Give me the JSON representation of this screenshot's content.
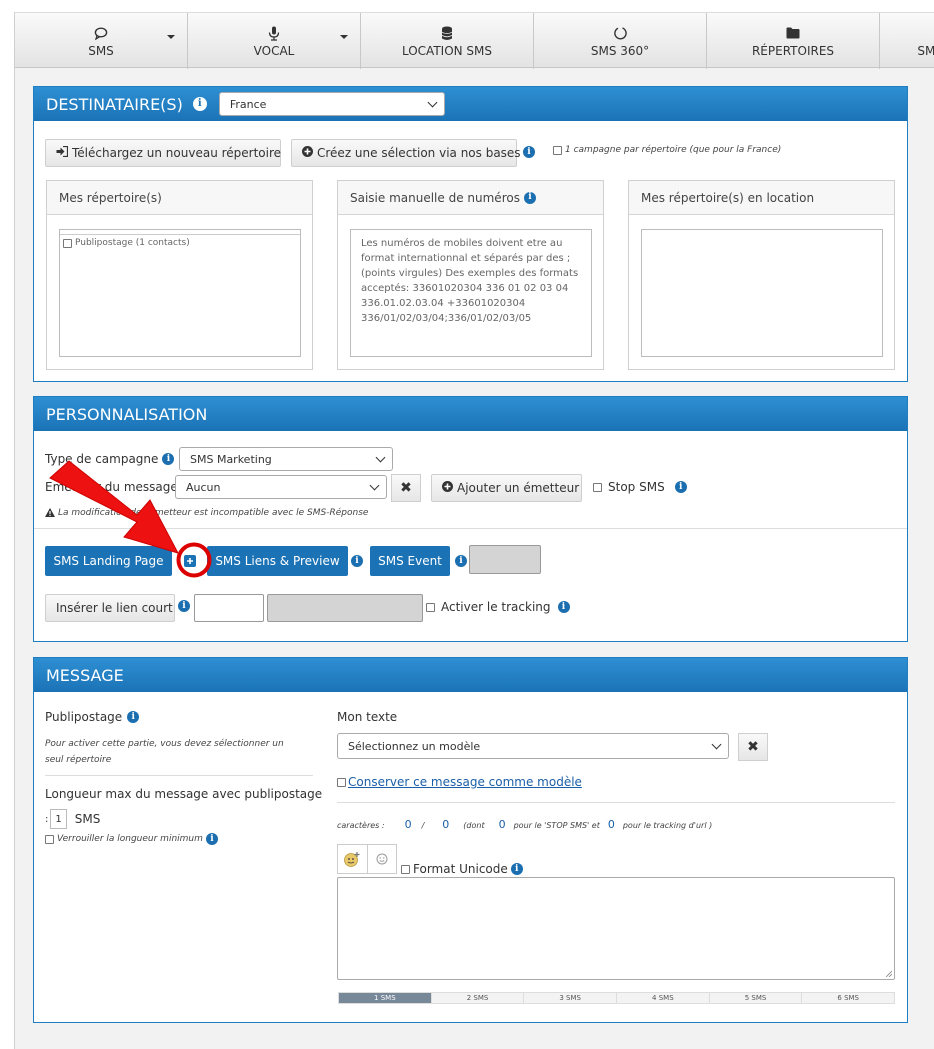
{
  "nav": [
    {
      "label": "SMS",
      "icon": "chat-bubble-icon",
      "dropdown": true
    },
    {
      "label": "VOCAL",
      "icon": "microphone-icon",
      "dropdown": true
    },
    {
      "label": "LOCATION SMS",
      "icon": "database-icon",
      "dropdown": false
    },
    {
      "label": "SMS 360°",
      "icon": "circle-refresh-icon",
      "dropdown": false
    },
    {
      "label": "RÉPERTOIRES",
      "icon": "folder-icon",
      "dropdown": false
    },
    {
      "label": "SMS",
      "icon": "",
      "dropdown": false
    }
  ],
  "destinataires": {
    "title": "DESTINATAIRE(S)",
    "country_selected": "France",
    "upload_button": "Téléchargez un nouveau répertoire",
    "create_button": "Créez une sélection via nos bases",
    "one_campaign_label": "1 campagne par répertoire (que pour la France)",
    "my_repertoires": {
      "title": "Mes répertoire(s)",
      "item": "Publipostage (1 contacts)"
    },
    "manual_entry": {
      "title": "Saisie manuelle de numéros",
      "placeholder": "Les numéros de mobiles doivent etre au format internationnal et séparés par des ; (points virgules) Des exemples des formats acceptés: 33601020304   336 01 02 03 04   336.01.02.03.04   +33601020304   336/01/02/03/04;336/01/02/03/05"
    },
    "rented": {
      "title": "Mes répertoire(s) en location"
    }
  },
  "personnalisation": {
    "title": "PERSONNALISATION",
    "campaign_type_label": "Type de campagne",
    "campaign_type_value": "SMS Marketing",
    "sender_label": "Emetteur du message",
    "sender_value": "Aucun",
    "add_sender_button": "Ajouter un émetteur",
    "stop_sms_label": "Stop SMS",
    "warning": "La modification de l'émetteur est incompatible avec le SMS-Réponse",
    "landing_page_button": "SMS Landing Page",
    "links_preview_button": "SMS Liens & Preview",
    "event_button": "SMS Event",
    "short_link_button": "Insérer le lien court",
    "tracking_label": "Activer le tracking"
  },
  "message": {
    "title": "MESSAGE",
    "publipostage_label": "Publipostage",
    "publipostage_note": "Pour activer cette partie, vous devez sélectionner un seul répertoire",
    "max_length_label": "Longueur max du message avec publipostage",
    "max_length_colon": ":",
    "max_length_value": "1",
    "max_length_unit": "SMS",
    "lock_min_label": "Verrouiller la longueur minimum",
    "my_text_label": "Mon texte",
    "model_select": "Sélectionnez un modèle",
    "keep_model_label": "Conserver ce message comme modèle",
    "chars_label": "caractères :",
    "chars_count": "0",
    "chars_slash": "/",
    "chars_total": "0",
    "dont_label": "(dont",
    "stop_count": "0",
    "stop_label": "pour le 'STOP SMS' et",
    "tracking_count": "0",
    "tracking_label": "pour le tracking d'url )",
    "unicode_label": "Format Unicode",
    "segments": [
      "1 SMS",
      "2 SMS",
      "3 SMS",
      "4 SMS",
      "5 SMS",
      "6 SMS"
    ],
    "active_segment": 0
  },
  "annotation": {
    "arrow_color": "#ee1111",
    "circle_color": "#dd0000"
  },
  "colors": {
    "header_blue": "#1b73b6",
    "button_blue": "#1b73b6",
    "link_blue": "#1a5fa8"
  }
}
